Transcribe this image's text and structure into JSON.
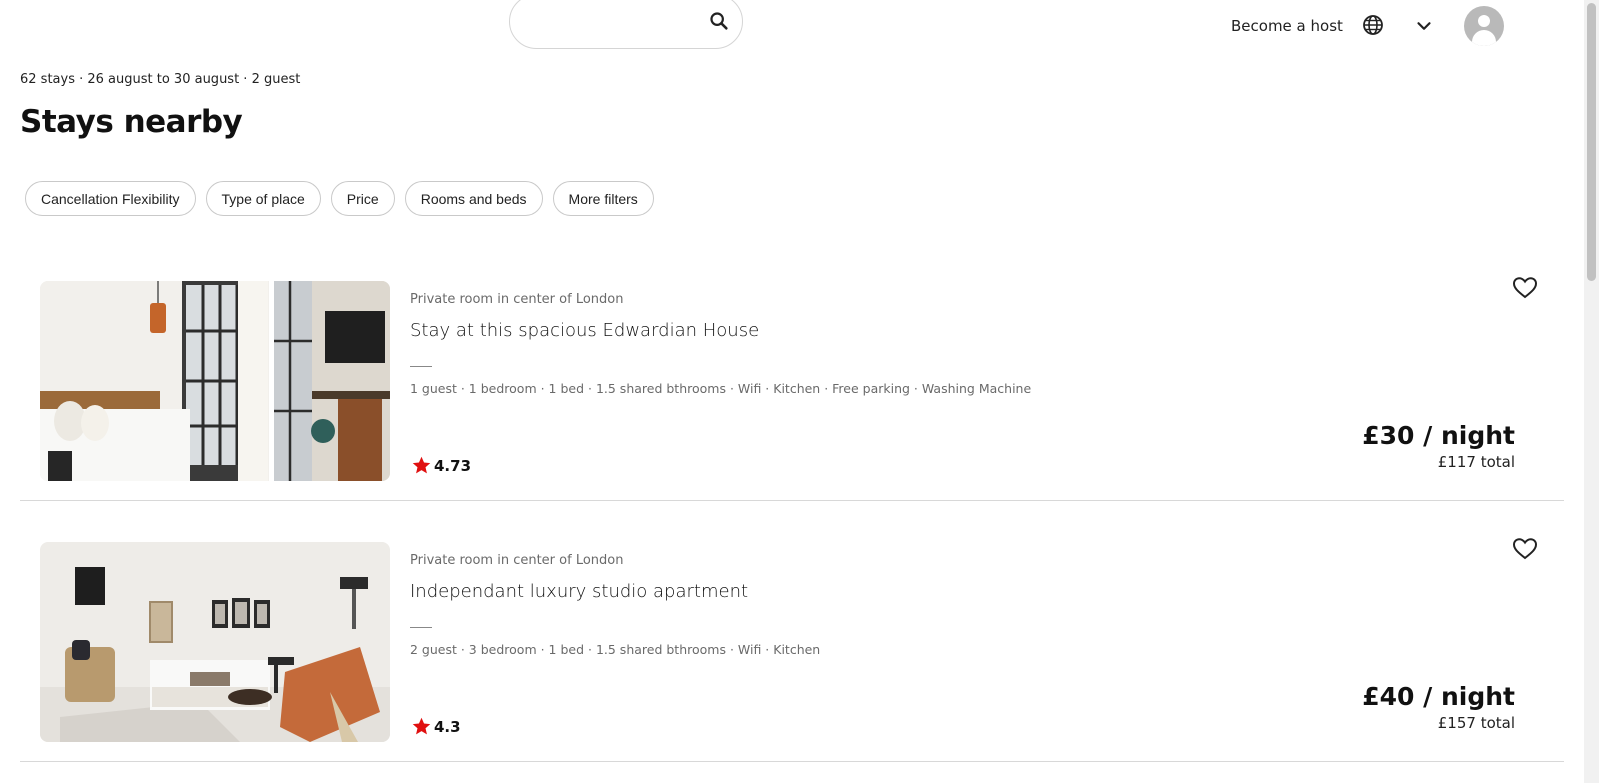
{
  "header": {
    "search_placeholder": "",
    "search_value": "",
    "become_host": "Become a host"
  },
  "summary": "62 stays · 26 august to 30 august · 2 guest",
  "title": "Stays nearby",
  "filters": [
    "Cancellation Flexibility",
    "Type of place",
    "Price",
    "Rooms and beds",
    "More filters"
  ],
  "listings": [
    {
      "subtitle": "Private room in center of London",
      "name": "Stay at this spacious Edwardian House",
      "amenities": "1 guest · 1 bedroom · 1 bed · 1.5 shared bthrooms · Wifi · Kitchen · Free parking · Washing Machine",
      "rating": "4.73",
      "price": "£30 / night",
      "total": "£117 total"
    },
    {
      "subtitle": "Private room in center of London",
      "name": "Independant luxury studio apartment",
      "amenities": "2 guest · 3 bedroom · 1 bed · 1.5 shared bthrooms · Wifi · Kitchen",
      "rating": "4.3",
      "price": "£40 / night",
      "total": "£157 total"
    }
  ],
  "colors": {
    "star": "#e01010",
    "border": "#d5d5d5",
    "muted": "#6a6a6a"
  },
  "icons": [
    "search-icon",
    "globe-icon",
    "chevron-down-icon",
    "avatar-icon",
    "heart-icon",
    "star-icon"
  ]
}
